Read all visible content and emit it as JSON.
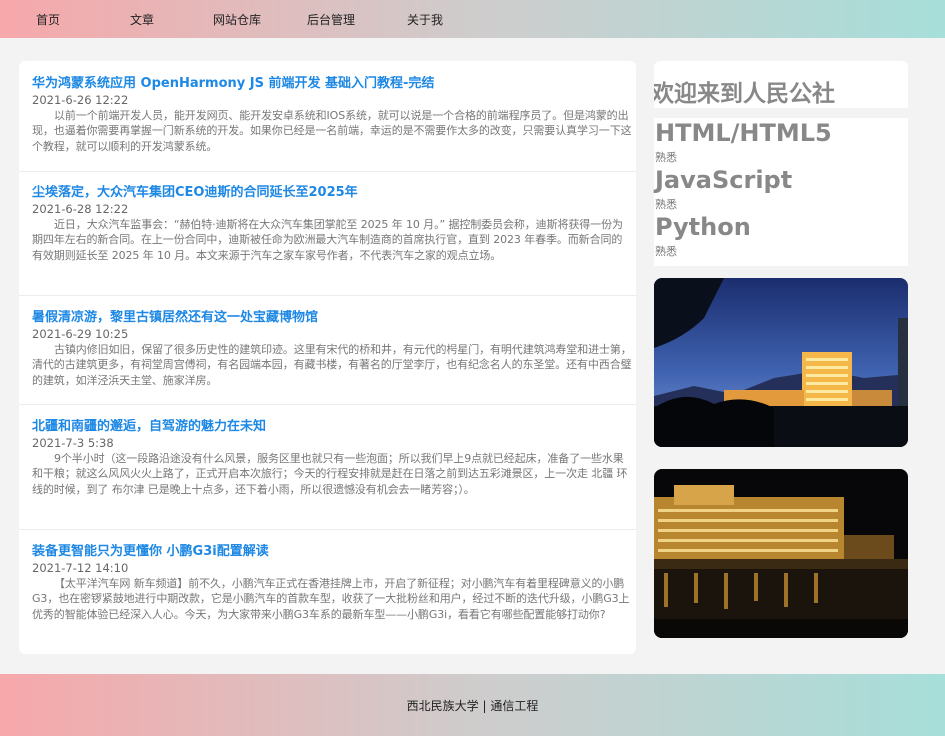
{
  "nav": [
    {
      "label": "首页"
    },
    {
      "label": "文章"
    },
    {
      "label": "网站仓库"
    },
    {
      "label": "后台管理"
    },
    {
      "label": "关于我"
    }
  ],
  "articles": [
    {
      "title": "华为鸿蒙系统应用 OpenHarmony JS 前端开发 基础入门教程-完结",
      "date": "2021-6-26 12:22",
      "body": "以前一个前端开发人员，能开发网页、能开发安卓系统和IOS系统，就可以说是一个合格的前端程序员了。但是鸿蒙的出现，也逼着你需要再掌握一门新系统的开发。如果你已经是一名前端，幸运的是不需要作太多的改变，只需要认真学习一下这个教程，就可以顺利的开发鸿蒙系统。"
    },
    {
      "title": "尘埃落定，大众汽车集团CEO迪斯的合同延长至2025年",
      "date": "2021-6-28 12:22",
      "body": "近日，大众汽车监事会：“赫伯特·迪斯将在大众汽车集团掌舵至 2025 年 10 月。” 据控制委员会称，迪斯将获得一份为期四年左右的新合同。在上一份合同中，迪斯被任命为欧洲最大汽车制造商的首席执行官，直到 2023 年春季。而新合同的有效期则延长至 2025 年 10 月。本文来源于汽车之家车家号作者，不代表汽车之家的观点立场。"
    },
    {
      "title": "暑假清凉游，黎里古镇居然还有这一处宝藏博物馆",
      "date": "2021-6-29 10:25",
      "body": "古镇内修旧如旧，保留了很多历史性的建筑印迹。这里有宋代的桥和井，有元代的枵星门，有明代建筑鸿寿堂和进士第，清代的古建筑更多，有祠堂周宫傅祠，有名园端本园，有藏书楼，有著名的厅堂李厅，也有纪念名人的东圣堂。还有中西合璧的建筑，如洋泾浜天主堂、施家洋房。"
    },
    {
      "title": "北疆和南疆的邂逅，自驾游的魅力在未知",
      "date": "2021-7-3 5:38",
      "body": "9个半小时（这一段路沿途没有什么风景，服务区里也就只有一些泡面；所以我们早上9点就已经起床，准备了一些水果和干粮；就这么风风火火上路了，正式开启本次旅行；今天的行程安排就是赶在日落之前到达五彩滩景区，上一次走 北疆 环线的时候，到了 布尔津 已是晚上十点多，还下着小雨，所以很遗憾没有机会去一睹芳容；）。"
    },
    {
      "title": "装备更智能只为更懂你 小鹏G3i配置解读",
      "date": "2021-7-12 14:10",
      "body": "【太平洋汽车网 新车频道】前不久，小鹏汽车正式在香港挂牌上市，开启了新征程；对小鹏汽车有着里程碑意义的小鹏G3，也在密锣紧鼓地进行中期改款，它是小鹏汽车的首款车型，收获了一大批粉丝和用户，经过不断的迭代升级，小鹏G3上优秀的智能体验已经深入人心。今天，为大家带来小鹏G3车系的最新车型——小鹏G3i，看看它有哪些配置能够打动你?"
    }
  ],
  "sidebar": {
    "title": "欢迎来到人民公社",
    "skills": [
      {
        "name": "HTML/HTML5",
        "level": "熟悉"
      },
      {
        "name": "JavaScript",
        "level": "熟悉"
      },
      {
        "name": "Python",
        "level": "熟悉"
      }
    ]
  },
  "footer": {
    "text": "西北民族大学 | 通信工程"
  }
}
